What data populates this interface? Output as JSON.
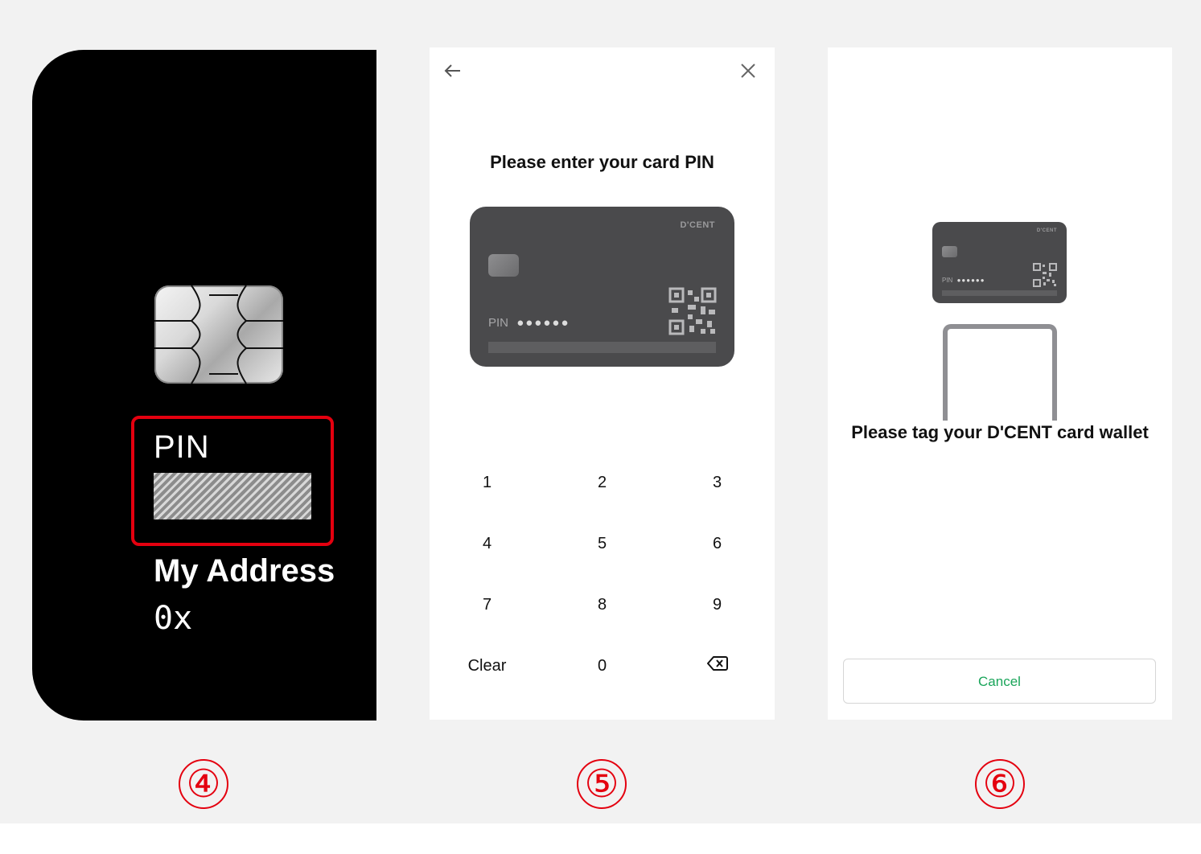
{
  "panel4": {
    "pin_label": "PIN",
    "address_label": "My Address",
    "address_value": "0x"
  },
  "panel5": {
    "title": "Please enter your card PIN",
    "card": {
      "brand": "D'CENT",
      "pin_label": "PIN",
      "pin_dots": "●●●●●●"
    },
    "keys": [
      [
        "1",
        "2",
        "3"
      ],
      [
        "4",
        "5",
        "6"
      ],
      [
        "7",
        "8",
        "9"
      ],
      [
        "Clear",
        "0",
        "backspace"
      ]
    ]
  },
  "panel6": {
    "card": {
      "brand": "D'CENT",
      "pin_label": "PIN",
      "pin_dots": "●●●●●●"
    },
    "title": "Please tag your D'CENT card wallet",
    "cancel_label": "Cancel"
  },
  "steps": [
    "④",
    "⑤",
    "⑥"
  ],
  "colors": {
    "highlight": "#e4000f",
    "cancel_text": "#1aa55a",
    "card_grey": "#4a4a4c"
  }
}
